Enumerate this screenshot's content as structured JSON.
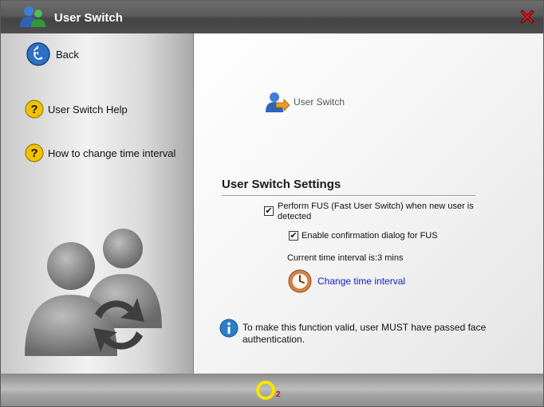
{
  "window": {
    "title": "User Switch",
    "icons": {
      "app": "users-icon",
      "close": "close-icon"
    }
  },
  "sidebar": {
    "back_label": "Back",
    "help_label": "User Switch Help",
    "interval_help_label": "How to change time interval",
    "icons": {
      "back": "back-arrow-icon",
      "help": "question-icon",
      "decoration": "users-refresh-icon"
    }
  },
  "main": {
    "header_label": "User Switch",
    "settings_title": "User Switch Settings",
    "fus_checkbox_label": "Perform FUS (Fast User Switch) when new user is detected",
    "fus_checked": true,
    "confirm_checkbox_label": "Enable confirmation dialog for FUS",
    "confirm_checked": true,
    "current_interval_text": "Current time interval is:3 mins",
    "change_interval_link": "Change time interval",
    "info_text": "To make this function valid, user MUST have passed face authentication.",
    "icons": {
      "header": "user-switch-icon",
      "clock": "clock-icon",
      "info": "info-icon"
    }
  },
  "footer": {
    "logo_icon": "o2-logo-icon"
  },
  "colors": {
    "titlebar": "#555555",
    "link": "#1122bb",
    "help_icon": "#f2c200",
    "info_icon": "#2a7fc9"
  }
}
